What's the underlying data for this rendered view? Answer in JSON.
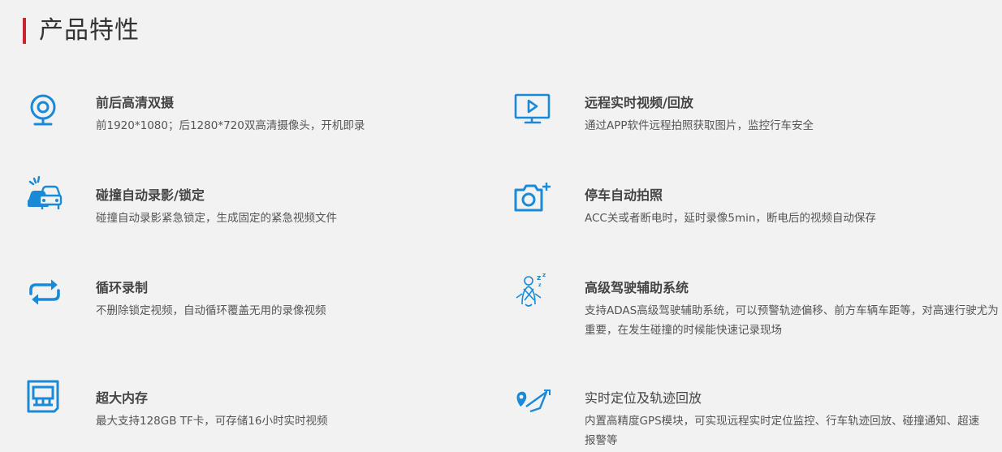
{
  "section": {
    "title": "产品特性",
    "accent_color": "#c9252b"
  },
  "icon_color": "#1a8ad8",
  "features": [
    {
      "icon": "webcam-icon",
      "title": "前后高清双摄",
      "desc": "前1920*1080；后1280*720双高清摄像头，开机即录"
    },
    {
      "icon": "monitor-play-icon",
      "title": "远程实时视频/回放",
      "desc": "通过APP软件远程拍照获取图片，监控行车安全"
    },
    {
      "icon": "car-collision-icon",
      "title": "碰撞自动录影/锁定",
      "desc": "碰撞自动录影紧急锁定，生成固定的紧急视频文件"
    },
    {
      "icon": "camera-plus-icon",
      "title": "停车自动拍照",
      "desc": "ACC关或者断电时，延时录像5min，断电后的视频自动保存"
    },
    {
      "icon": "loop-arrows-icon",
      "title": "循环录制",
      "desc": "不删除锁定视频，自动循环覆盖无用的录像视频"
    },
    {
      "icon": "drowsy-driver-icon",
      "title": "高级驾驶辅助系统",
      "desc": "支持ADAS高级驾驶辅助系统，可以预警轨迹偏移、前方车辆车距等，对高速行驶尤为重要，在发生碰撞的时候能快速记录现场"
    },
    {
      "icon": "memory-card-icon",
      "title": "超大内存",
      "desc": "最大支持128GB TF卡，可存储16小时实时视频"
    },
    {
      "icon": "gps-route-icon",
      "title": "实时定位及轨迹回放",
      "desc": "内置高精度GPS模块，可实现远程实时定位监控、行车轨迹回放、碰撞通知、超速报警等"
    }
  ]
}
